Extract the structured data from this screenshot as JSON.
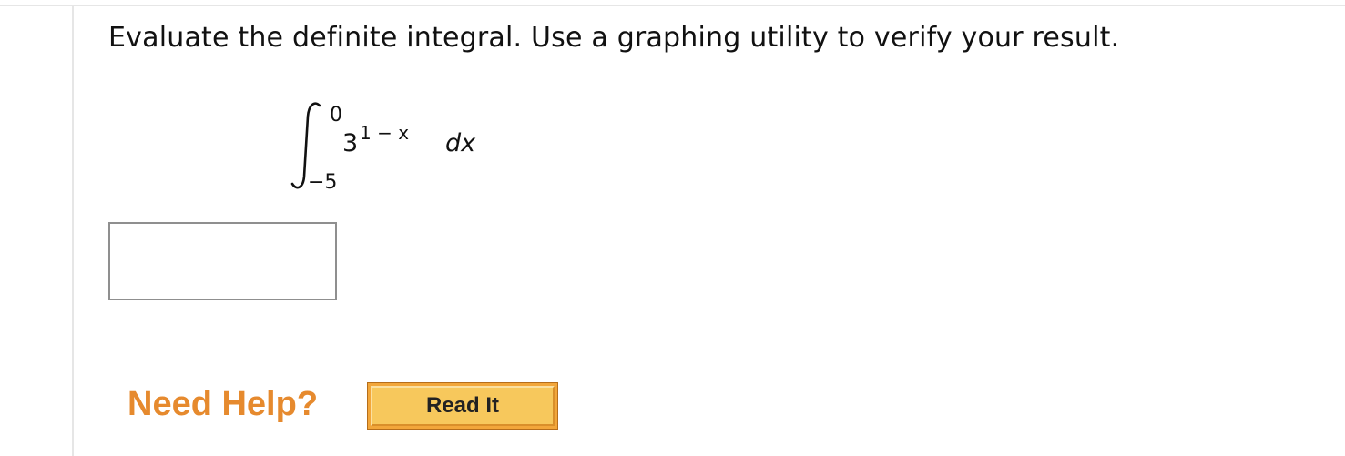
{
  "question": {
    "prompt": "Evaluate the definite integral. Use a graphing utility to verify your result."
  },
  "integral": {
    "upper_limit": "0",
    "lower_limit": "−5",
    "base": "3",
    "exponent": "1 − x",
    "differential": "dx"
  },
  "answer": {
    "value": "",
    "placeholder": ""
  },
  "help": {
    "label": "Need Help?",
    "read_it_label": "Read It"
  },
  "colors": {
    "help_text": "#e68a2e",
    "button_face": "#f7c85c",
    "button_border": "#f2a63a",
    "rule": "#e6e6e6"
  },
  "icons": {
    "integral_sign": "integral-symbol"
  }
}
